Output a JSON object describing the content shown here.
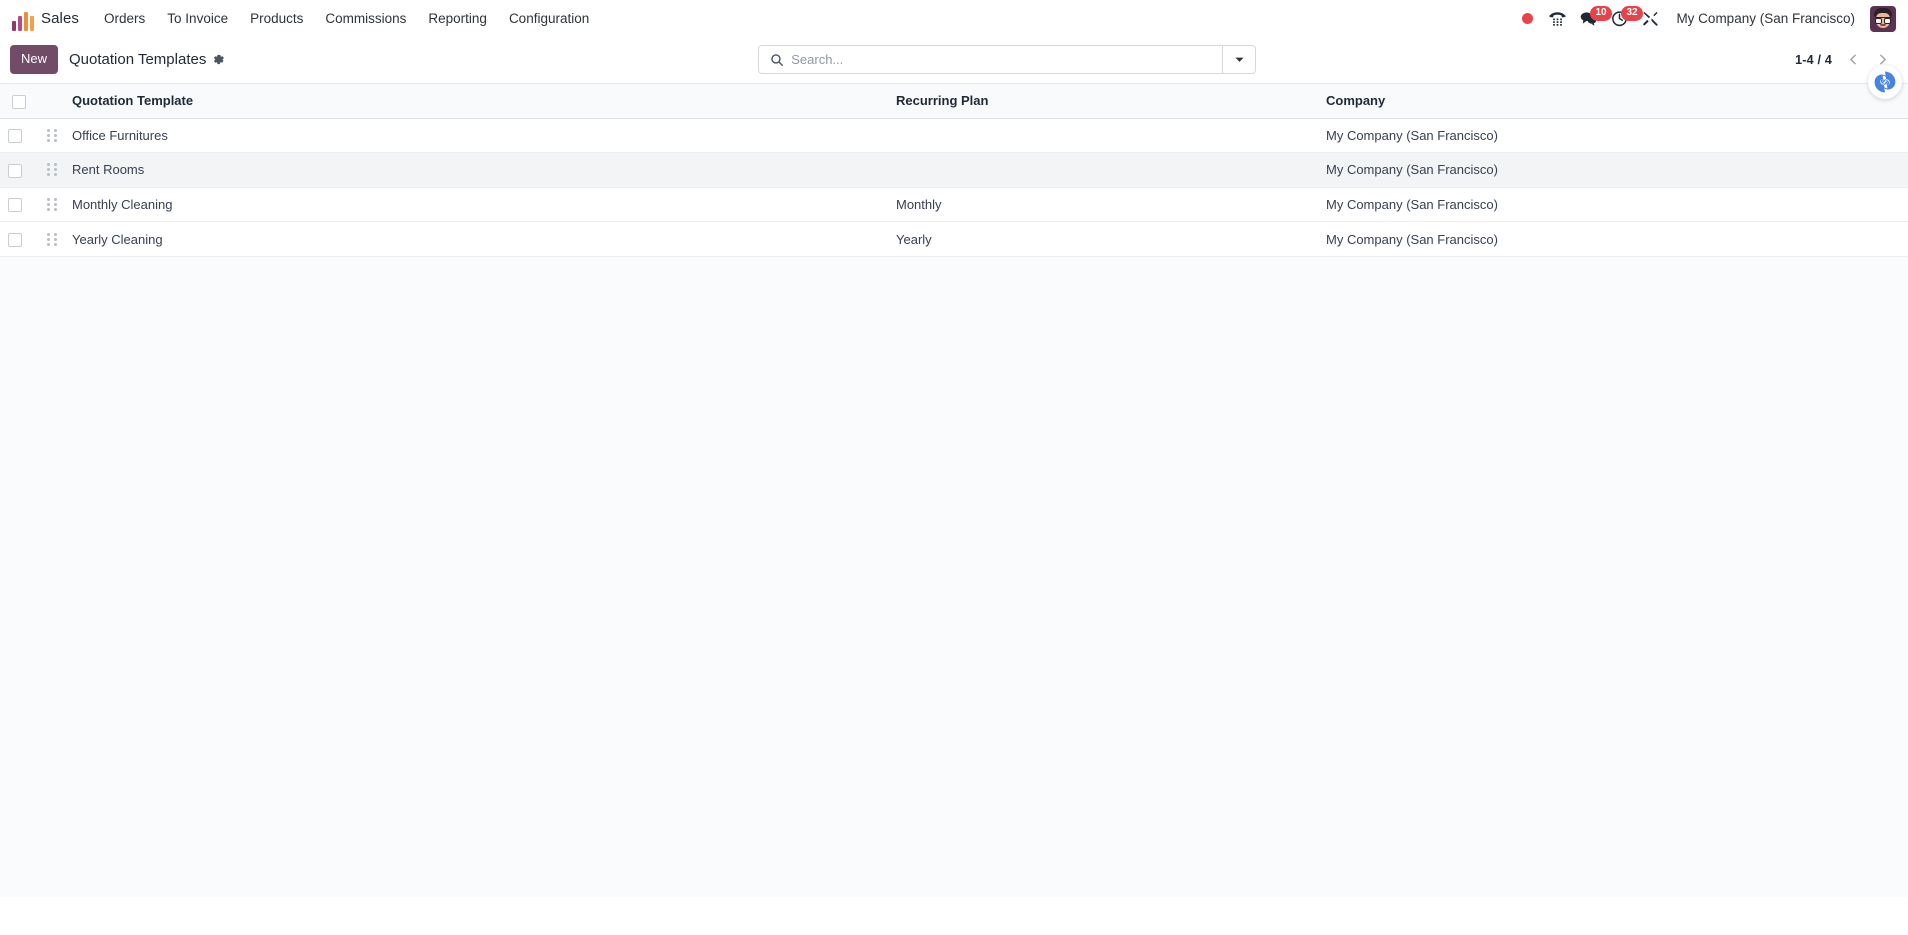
{
  "navbar": {
    "logo_icon": "odoo-sales-bars-logo",
    "app_name": "Sales",
    "menu_items": [
      {
        "label": "Orders",
        "name": "menu-orders"
      },
      {
        "label": "To Invoice",
        "name": "menu-to-invoice"
      },
      {
        "label": "Products",
        "name": "menu-products"
      },
      {
        "label": "Commissions",
        "name": "menu-commissions"
      },
      {
        "label": "Reporting",
        "name": "menu-reporting"
      },
      {
        "label": "Configuration",
        "name": "menu-configuration"
      }
    ],
    "systray": {
      "recording_dot": {
        "icon": "record-dot-icon",
        "color": "#e6434b"
      },
      "voip": {
        "icon": "phone-dialpad-icon"
      },
      "messages": {
        "icon": "chat-bubble-icon",
        "badge": "10"
      },
      "activities": {
        "icon": "clock-activity-icon",
        "badge": "32"
      },
      "developer_tools": {
        "icon": "tools-crossed-icon"
      }
    },
    "company": "My Company (San Francisco)",
    "avatar": "user-avatar"
  },
  "control_panel": {
    "new_label": "New",
    "title": "Quotation Templates",
    "settings_icon": "gear-icon",
    "search": {
      "icon": "search-icon",
      "placeholder": "Search...",
      "value": "",
      "dropdown_icon": "caret-down-icon"
    },
    "pager": {
      "value": "1-4 / 4",
      "prev_icon": "chevron-left-icon",
      "next_icon": "chevron-right-icon"
    }
  },
  "list": {
    "columns": [
      {
        "label": "Quotation Template",
        "name": "column-quotation-template"
      },
      {
        "label": "Recurring Plan",
        "name": "column-recurring-plan"
      },
      {
        "label": "Company",
        "name": "column-company"
      }
    ],
    "rows": [
      {
        "name": "Office Furnitures",
        "recurring_plan": "",
        "company": "My Company (San Francisco)",
        "hovered": false
      },
      {
        "name": "Rent Rooms",
        "recurring_plan": "",
        "company": "My Company (San Francisco)",
        "hovered": true
      },
      {
        "name": "Monthly Cleaning",
        "recurring_plan": "Monthly",
        "company": "My Company (San Francisco)",
        "hovered": false
      },
      {
        "name": "Yearly Cleaning",
        "recurring_plan": "Yearly",
        "company": "My Company (San Francisco)",
        "hovered": false
      }
    ]
  },
  "helper": {
    "icon": "odoo-swirl-icon",
    "color": "#3b7ddd"
  },
  "colors": {
    "brand_purple": "#714b67",
    "badge_red": "#e6434b",
    "header_bg": "#f9fafb",
    "row_hover": "#f3f4f5"
  }
}
